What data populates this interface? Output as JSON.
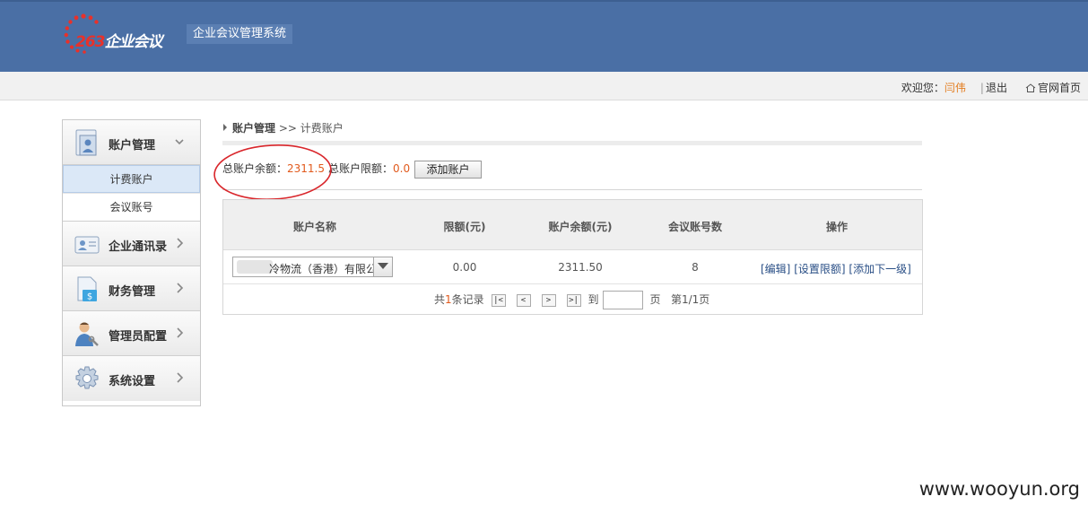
{
  "header": {
    "brand_num": "263",
    "brand_text": "企业会议",
    "system_name": "企业会议管理系统"
  },
  "topbar": {
    "welcome": "欢迎您：",
    "user": "闫伟",
    "sep": "|",
    "logout": "退出",
    "home": "官网首页"
  },
  "sidebar": {
    "items": [
      {
        "label": "账户管理",
        "icon": "account-icon",
        "expanded": true
      },
      {
        "label": "企业通讯录",
        "icon": "contacts-icon"
      },
      {
        "label": "财务管理",
        "icon": "finance-icon"
      },
      {
        "label": "管理员配置",
        "icon": "admin-icon"
      },
      {
        "label": "系统设置",
        "icon": "gear-icon"
      }
    ],
    "subitems": [
      {
        "label": "计费账户",
        "active": true
      },
      {
        "label": "会议账号"
      }
    ]
  },
  "breadcrumb": {
    "root": "账户管理",
    "sep": ">>",
    "current": "计费账户"
  },
  "summary": {
    "balance_label": "总账户余额：",
    "balance_value": "2311.5",
    "limit_label": "总账户限额：",
    "limit_value": "0.0",
    "add_button": "添加账户"
  },
  "table": {
    "headers": [
      "账户名称",
      "限额(元)",
      "账户余额(元)",
      "会议账号数",
      "操作"
    ],
    "rows": [
      {
        "name": "冷物流（香港）有限公司",
        "limit": "0.00",
        "balance": "2311.50",
        "count": "8",
        "op_edit": "[编辑]",
        "op_limit": "[设置限额]",
        "op_add": "[添加下一级]"
      }
    ]
  },
  "pager": {
    "prefix": "共",
    "count": "1",
    "suffix": "条记录",
    "first": "|<",
    "prev": "<",
    "next": ">",
    "last": ">|",
    "goto": "到",
    "page_unit": "页",
    "page_info": "第1/1页"
  },
  "watermark": "www.wooyun.org",
  "colors": {
    "header_bg": "#4a6fa5",
    "highlight": "#e15a1d",
    "annotation_circle": "#d9262b",
    "link": "#2a4f86"
  }
}
